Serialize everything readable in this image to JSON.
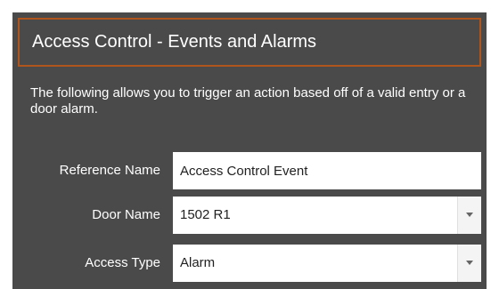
{
  "panel": {
    "title": "Access Control - Events and Alarms",
    "accent_color": "#b0561d",
    "background_color": "#4a4a4a",
    "description": "The following allows you to trigger an action based off of a valid entry or a door alarm."
  },
  "form": {
    "reference_name": {
      "label": "Reference Name",
      "value": "Access Control Event"
    },
    "door_name": {
      "label": "Door Name",
      "value": "1502 R1",
      "icon": "chevron-down-icon"
    },
    "access_type": {
      "label": "Access Type",
      "value": "Alarm",
      "icon": "chevron-down-icon"
    }
  }
}
